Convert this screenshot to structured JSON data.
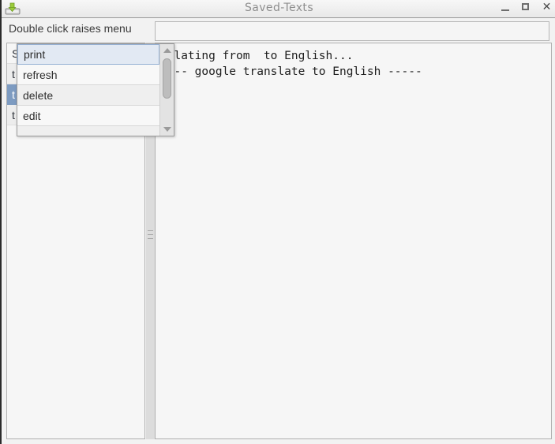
{
  "window": {
    "title": "Saved-Texts",
    "icon": "save-disk-icon",
    "controls": {
      "minimize": "–",
      "maximize": "□",
      "close": "✕"
    }
  },
  "header": {
    "hint": "Double click raises menu",
    "entry_value": "",
    "entry_placeholder": ""
  },
  "left_panel": {
    "items": [
      {
        "label": "S",
        "selected": false
      },
      {
        "label": "t",
        "selected": false
      },
      {
        "label": "t",
        "selected": true
      },
      {
        "label": "t",
        "selected": false
      }
    ]
  },
  "popup_menu": {
    "items": [
      {
        "label": "print",
        "active": true
      },
      {
        "label": "refresh",
        "active": false
      },
      {
        "label": "delete",
        "active": false
      },
      {
        "label": "edit",
        "active": false
      },
      {
        "label": "",
        "active": false
      }
    ],
    "scrollbar": {
      "up_arrow": "▲",
      "down_arrow": "▼"
    }
  },
  "right_panel": {
    "console_lines": [
      "nslating from  to English...",
      "---- google translate to English -----"
    ]
  },
  "colors": {
    "selection_blue": "#7d9bc1",
    "menu_active_bg": "#e2e9f3",
    "menu_active_border": "#95b0d4",
    "titlebar_text": "#8e8e8e",
    "panel_bg": "#f6f6f6",
    "splitter_bg": "#dcdcdc",
    "icon_green": "#8dc63f"
  }
}
